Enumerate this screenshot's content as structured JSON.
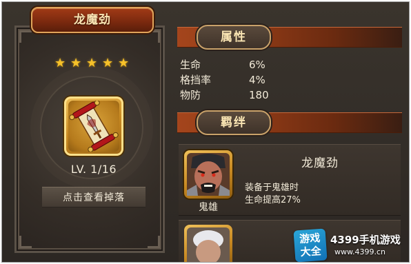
{
  "item": {
    "name": "龙魔劲",
    "star_count": 5,
    "level_text": "LV. 1/16",
    "drop_button_label": "点击查看掉落",
    "icon": "scroll-sword-icon"
  },
  "attributes": {
    "section_label": "属性",
    "rows": [
      {
        "name": "生命",
        "value": "6%"
      },
      {
        "name": "格挡率",
        "value": "4%"
      },
      {
        "name": "物防",
        "value": "180"
      }
    ]
  },
  "bonds": {
    "section_label": "羁绊",
    "items": [
      {
        "title": "龙魔劲",
        "hero_name": "鬼雄",
        "description_line1": "装备于鬼雄时",
        "description_line2": "生命提高27%"
      }
    ]
  },
  "watermark": {
    "logo_top": "游戏",
    "logo_bottom": "大全",
    "title": "4399手机游戏",
    "url": "www.4399.cn"
  },
  "colors": {
    "accent_gold": "#f6c12a",
    "banner_red": "#a4451c",
    "text_cream": "#f2ead8",
    "panel_dark": "#2c2723"
  }
}
